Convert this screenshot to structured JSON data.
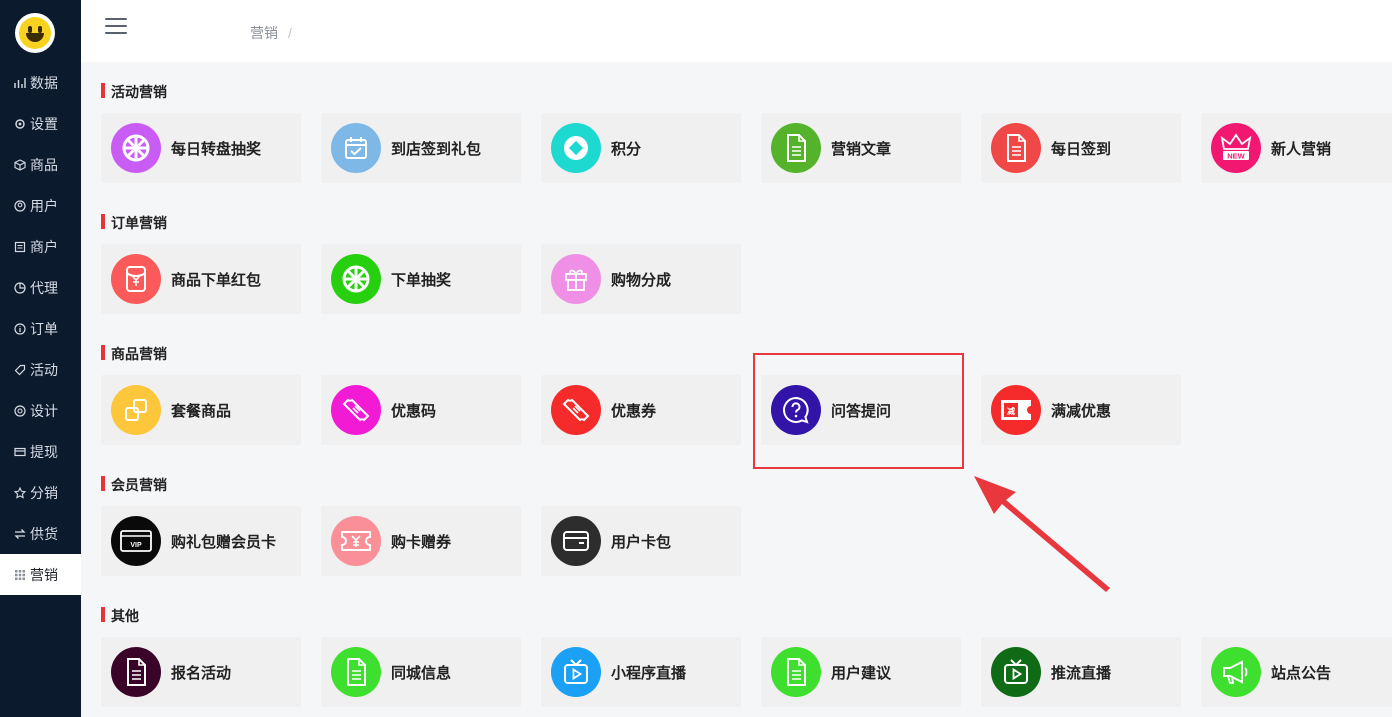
{
  "sidebar": {
    "items": [
      {
        "label": "数据",
        "icon": "chart-icon"
      },
      {
        "label": "设置",
        "icon": "gear-icon"
      },
      {
        "label": "商品",
        "icon": "box-icon"
      },
      {
        "label": "用户",
        "icon": "user-icon"
      },
      {
        "label": "商户",
        "icon": "store-icon"
      },
      {
        "label": "代理",
        "icon": "pie-icon"
      },
      {
        "label": "订单",
        "icon": "info-icon"
      },
      {
        "label": "活动",
        "icon": "tag-icon"
      },
      {
        "label": "设计",
        "icon": "palette-icon"
      },
      {
        "label": "提现",
        "icon": "card-icon"
      },
      {
        "label": "分销",
        "icon": "star-icon"
      },
      {
        "label": "供货",
        "icon": "swap-icon"
      },
      {
        "label": "营销",
        "icon": "grid-icon"
      }
    ],
    "active": "营销"
  },
  "header": {
    "breadcrumb": "营销",
    "separator": "/"
  },
  "sections": [
    {
      "title": "活动营销",
      "items": [
        {
          "label": "每日转盘抽奖",
          "icon": "wheel-icon",
          "color": "#c95cf4"
        },
        {
          "label": "到店签到礼包",
          "icon": "calendar-check-icon",
          "color": "#7db8e6"
        },
        {
          "label": "积分",
          "icon": "diamond-icon",
          "color": "#1ed9d0"
        },
        {
          "label": "营销文章",
          "icon": "document-icon",
          "color": "#55b22b"
        },
        {
          "label": "每日签到",
          "icon": "document-icon",
          "color": "#f04747"
        },
        {
          "label": "新人营销",
          "icon": "crown-new-icon",
          "color": "#f21871"
        }
      ]
    },
    {
      "title": "订单营销",
      "items": [
        {
          "label": "商品下单红包",
          "icon": "red-envelope-icon",
          "color": "#fa5a5a"
        },
        {
          "label": "下单抽奖",
          "icon": "wheel-icon",
          "color": "#27d00f"
        },
        {
          "label": "购物分成",
          "icon": "gift-icon",
          "color": "#f08fe6"
        }
      ]
    },
    {
      "title": "商品营销",
      "items": [
        {
          "label": "套餐商品",
          "icon": "stack-icon",
          "color": "#fdc63b"
        },
        {
          "label": "优惠码",
          "icon": "ticket-icon",
          "color": "#f21ad5"
        },
        {
          "label": "优惠券",
          "icon": "ticket-icon",
          "color": "#f52a2a"
        },
        {
          "label": "问答提问",
          "icon": "question-icon",
          "color": "#3214a9"
        },
        {
          "label": "满减优惠",
          "icon": "discount-icon",
          "color": "#f52a2a"
        }
      ]
    },
    {
      "title": "会员营销",
      "items": [
        {
          "label": "购礼包赠会员卡",
          "icon": "vip-card-icon",
          "color": "#0a0a0a"
        },
        {
          "label": "购卡赠券",
          "icon": "yen-ticket-icon",
          "color": "#fa8f97"
        },
        {
          "label": "用户卡包",
          "icon": "wallet-icon",
          "color": "#2d2d2d"
        }
      ]
    },
    {
      "title": "其他",
      "items": [
        {
          "label": "报名活动",
          "icon": "document-icon",
          "color": "#3a0429"
        },
        {
          "label": "同城信息",
          "icon": "document-icon",
          "color": "#3fdf2f"
        },
        {
          "label": "小程序直播",
          "icon": "tv-icon",
          "color": "#1aa0f5"
        },
        {
          "label": "用户建议",
          "icon": "document-icon",
          "color": "#3fdf2f"
        },
        {
          "label": "推流直播",
          "icon": "tv-icon",
          "color": "#0f6b16"
        },
        {
          "label": "站点公告",
          "icon": "megaphone-icon",
          "color": "#3fdf2f"
        }
      ]
    }
  ]
}
